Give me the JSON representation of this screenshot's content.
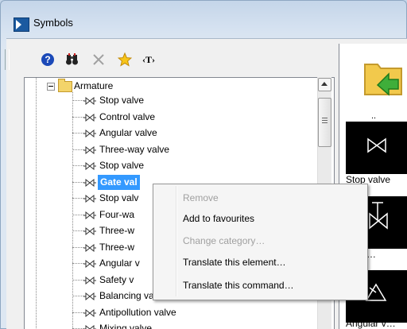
{
  "window": {
    "title": "Symbols"
  },
  "toolbar": {
    "help_glyph": "?",
    "find_icon": "binoculars-icon",
    "delete_icon": "close-icon",
    "favourite_icon": "star-icon",
    "text_glyph": "‹T›"
  },
  "tree": {
    "root": "Armature",
    "items": [
      "Stop valve",
      "Control valve",
      "Angular valve",
      "Three-way valve",
      "Stop valve",
      "Gate valve",
      "Stop valv",
      "Four-wa",
      "Three-w",
      "Three-w",
      "Angular v",
      "Safety v",
      "Balancing valve",
      "Antipollution valve",
      "Mixing valve"
    ],
    "selected_index": 5,
    "selected_display": "Gate val"
  },
  "preview": {
    "up_label": "..",
    "tiles": [
      "Stop valve",
      "trol v…",
      "Angular v…"
    ]
  },
  "context_menu": {
    "items": [
      {
        "label": "Remove",
        "enabled": false
      },
      {
        "label": "Add to favourites",
        "enabled": true
      },
      {
        "label": "Change category…",
        "enabled": false
      },
      {
        "label": "Translate this element…",
        "enabled": true
      },
      {
        "label": "Translate this command…",
        "enabled": true
      }
    ]
  },
  "colors": {
    "selection": "#3399ff",
    "title_bar": "#c4d5e9"
  }
}
